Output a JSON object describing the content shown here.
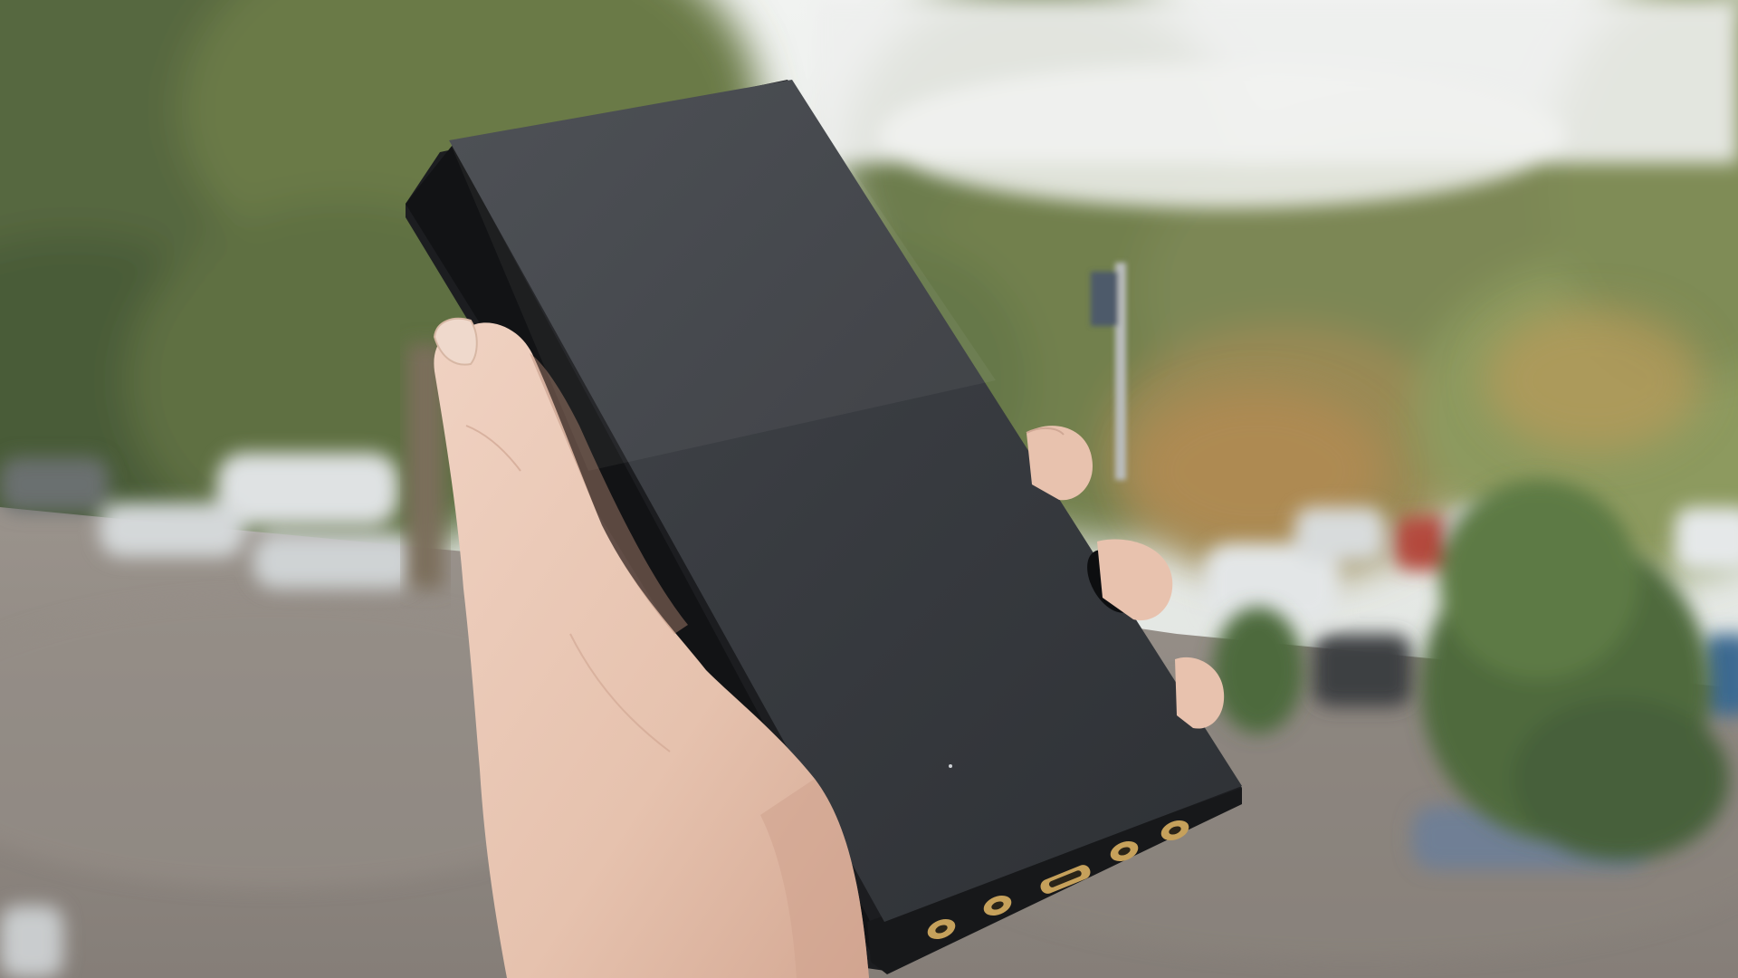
{
  "scene": {
    "description_label": "",
    "colors": {
      "sky": "#e9ecea",
      "foliage_dark": "#4e5f3a",
      "foliage_mid": "#6f7f4c",
      "foliage_light": "#9aa46a",
      "autumn": "#b78a52",
      "pavement": "#8e8781",
      "device_body": "#1c1d20",
      "device_screen": "#3a3d42",
      "skin": "#e8c6b4",
      "skin_shadow": "#c99e8a",
      "gold_port": "#c6a15b",
      "car_white": "#dfe2e3",
      "car_red": "#b4483d",
      "car_blue": "#3d6b92"
    },
    "subjects": [
      "hand-icon",
      "audio-player-device",
      "blurred-trees",
      "parked-cars",
      "pavement"
    ]
  }
}
